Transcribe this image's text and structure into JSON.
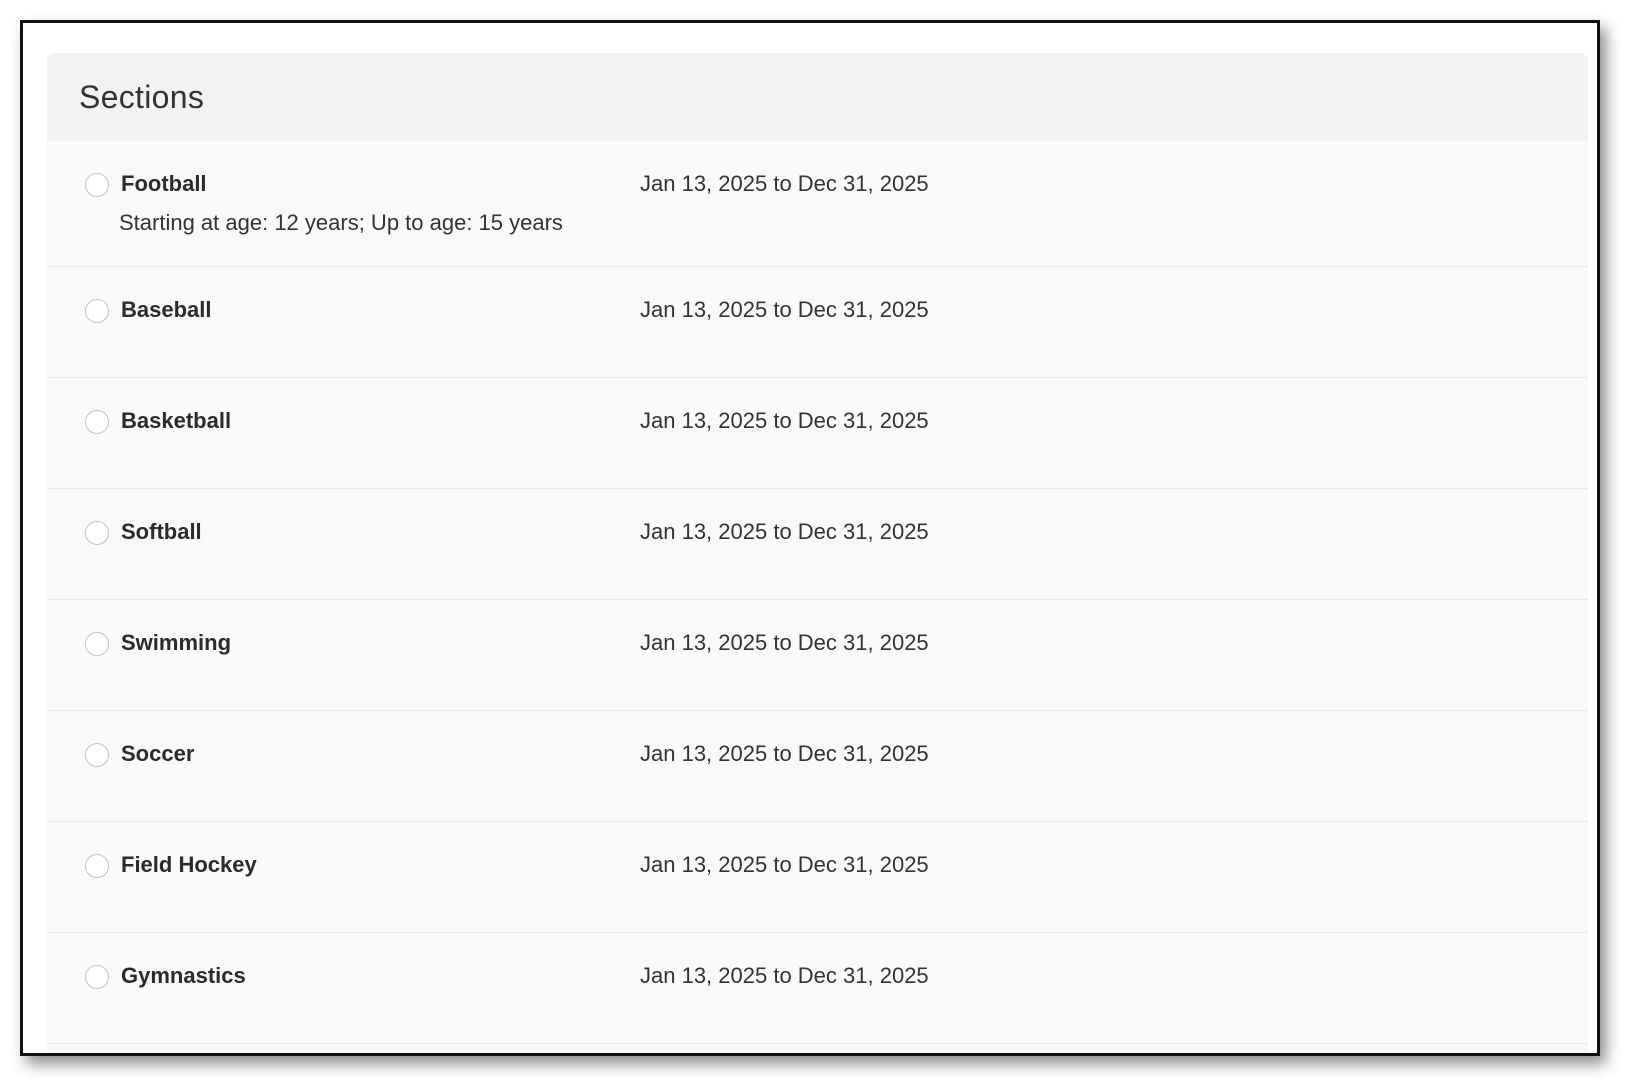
{
  "panel": {
    "title": "Sections"
  },
  "sections": [
    {
      "name": "Football",
      "dates": "Jan 13, 2025 to Dec 31, 2025",
      "age": "Starting at age: 12 years; Up to age: 15 years"
    },
    {
      "name": "Baseball",
      "dates": "Jan 13, 2025 to Dec 31, 2025"
    },
    {
      "name": "Basketball",
      "dates": "Jan 13, 2025 to Dec 31, 2025"
    },
    {
      "name": "Softball",
      "dates": "Jan 13, 2025 to Dec 31, 2025"
    },
    {
      "name": "Swimming",
      "dates": "Jan 13, 2025 to Dec 31, 2025"
    },
    {
      "name": "Soccer",
      "dates": "Jan 13, 2025 to Dec 31, 2025"
    },
    {
      "name": "Field Hockey",
      "dates": "Jan 13, 2025 to Dec 31, 2025"
    },
    {
      "name": "Gymnastics",
      "dates": "Jan 13, 2025 to Dec 31, 2025"
    }
  ],
  "colors": {
    "header_bg": "#f2f2f2",
    "row_bg": "#f9f9f9",
    "divider": "#e6e6e6",
    "text": "#333333"
  }
}
